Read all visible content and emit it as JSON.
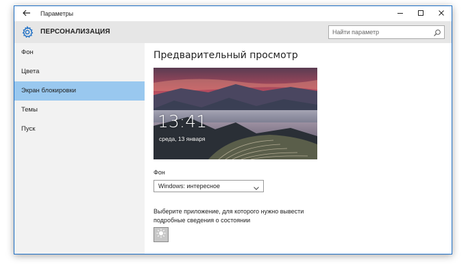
{
  "titlebar": {
    "title": "Параметры",
    "back_icon": "arrow-left-icon",
    "controls": [
      "minimize-icon",
      "maximize-icon",
      "close-icon"
    ]
  },
  "header": {
    "icon": "gear-icon",
    "page_title": "ПЕРСОНАЛИЗАЦИЯ",
    "search_placeholder": "Найти параметр",
    "search_icon": "search-icon"
  },
  "sidebar": {
    "items": [
      {
        "label": "Фон",
        "active": false
      },
      {
        "label": "Цвета",
        "active": false
      },
      {
        "label": "Экран блокировки",
        "active": true
      },
      {
        "label": "Темы",
        "active": false
      },
      {
        "label": "Пуск",
        "active": false
      }
    ]
  },
  "content": {
    "section_title": "Предварительный просмотр",
    "preview": {
      "time": "13:41",
      "date": "среда, 13 января"
    },
    "background_label": "Фон",
    "background_value": "Windows: интересное",
    "app_label": "Выберите приложение, для которого нужно вывести подробные сведения о состоянии",
    "app_tile_icon": "sun-icon"
  },
  "colors": {
    "accent": "#1e6fc5",
    "selected_nav": "#99c8ef",
    "header_bg": "#e6e6e6",
    "sidebar_bg": "#f2f2f2"
  }
}
